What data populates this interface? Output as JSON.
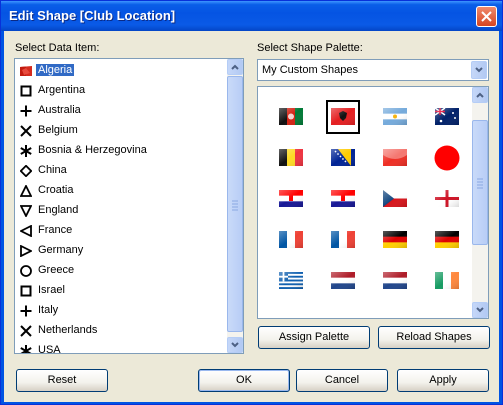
{
  "window": {
    "title": "Edit Shape [Club Location]"
  },
  "labels": {
    "select_data_item": "Select Data Item:",
    "select_shape_palette": "Select Shape Palette:"
  },
  "data_items": [
    {
      "label": "Algeria",
      "icon": "flag-algeria-icon",
      "selected": true
    },
    {
      "label": "Argentina",
      "icon": "square-outline-icon"
    },
    {
      "label": "Australia",
      "icon": "plus-icon"
    },
    {
      "label": "Belgium",
      "icon": "cross-x-icon"
    },
    {
      "label": "Bosnia & Herzegovina",
      "icon": "asterisk-icon"
    },
    {
      "label": "China",
      "icon": "diamond-icon"
    },
    {
      "label": "Croatia",
      "icon": "triangle-up-icon"
    },
    {
      "label": "England",
      "icon": "triangle-down-icon"
    },
    {
      "label": "France",
      "icon": "triangle-left-icon"
    },
    {
      "label": "Germany",
      "icon": "triangle-right-icon"
    },
    {
      "label": "Greece",
      "icon": "circle-outline-icon"
    },
    {
      "label": "Israel",
      "icon": "square-outline-icon"
    },
    {
      "label": "Italy",
      "icon": "plus-icon"
    },
    {
      "label": "Netherlands",
      "icon": "cross-x-icon"
    },
    {
      "label": "USA",
      "icon": "asterisk-icon"
    }
  ],
  "palette_select": {
    "value": "My Custom Shapes"
  },
  "shapes": [
    {
      "name": "afghanistan-flag-icon"
    },
    {
      "name": "albania-flag-icon",
      "selected": true
    },
    {
      "name": "argentina-flag-icon"
    },
    {
      "name": "australia-flag-icon"
    },
    {
      "name": "belgium-flag-icon"
    },
    {
      "name": "bosnia-flag-icon"
    },
    {
      "name": "red-white-flag-icon"
    },
    {
      "name": "red-circle-icon"
    },
    {
      "name": "croatia-flag-icon"
    },
    {
      "name": "croatia-flag-2-icon"
    },
    {
      "name": "czech-flag-icon"
    },
    {
      "name": "england-flag-icon"
    },
    {
      "name": "france-flag-icon"
    },
    {
      "name": "france-flag-2-icon"
    },
    {
      "name": "germany-flag-icon"
    },
    {
      "name": "germany-flag-2-icon"
    },
    {
      "name": "greece-flag-icon"
    },
    {
      "name": "netherlands-flag-icon"
    },
    {
      "name": "netherlands-flag-2-icon"
    },
    {
      "name": "ireland-flag-icon"
    }
  ],
  "buttons": {
    "assign_palette": "Assign Palette",
    "reload_shapes": "Reload Shapes",
    "reset": "Reset",
    "ok": "OK",
    "cancel": "Cancel",
    "apply": "Apply"
  }
}
